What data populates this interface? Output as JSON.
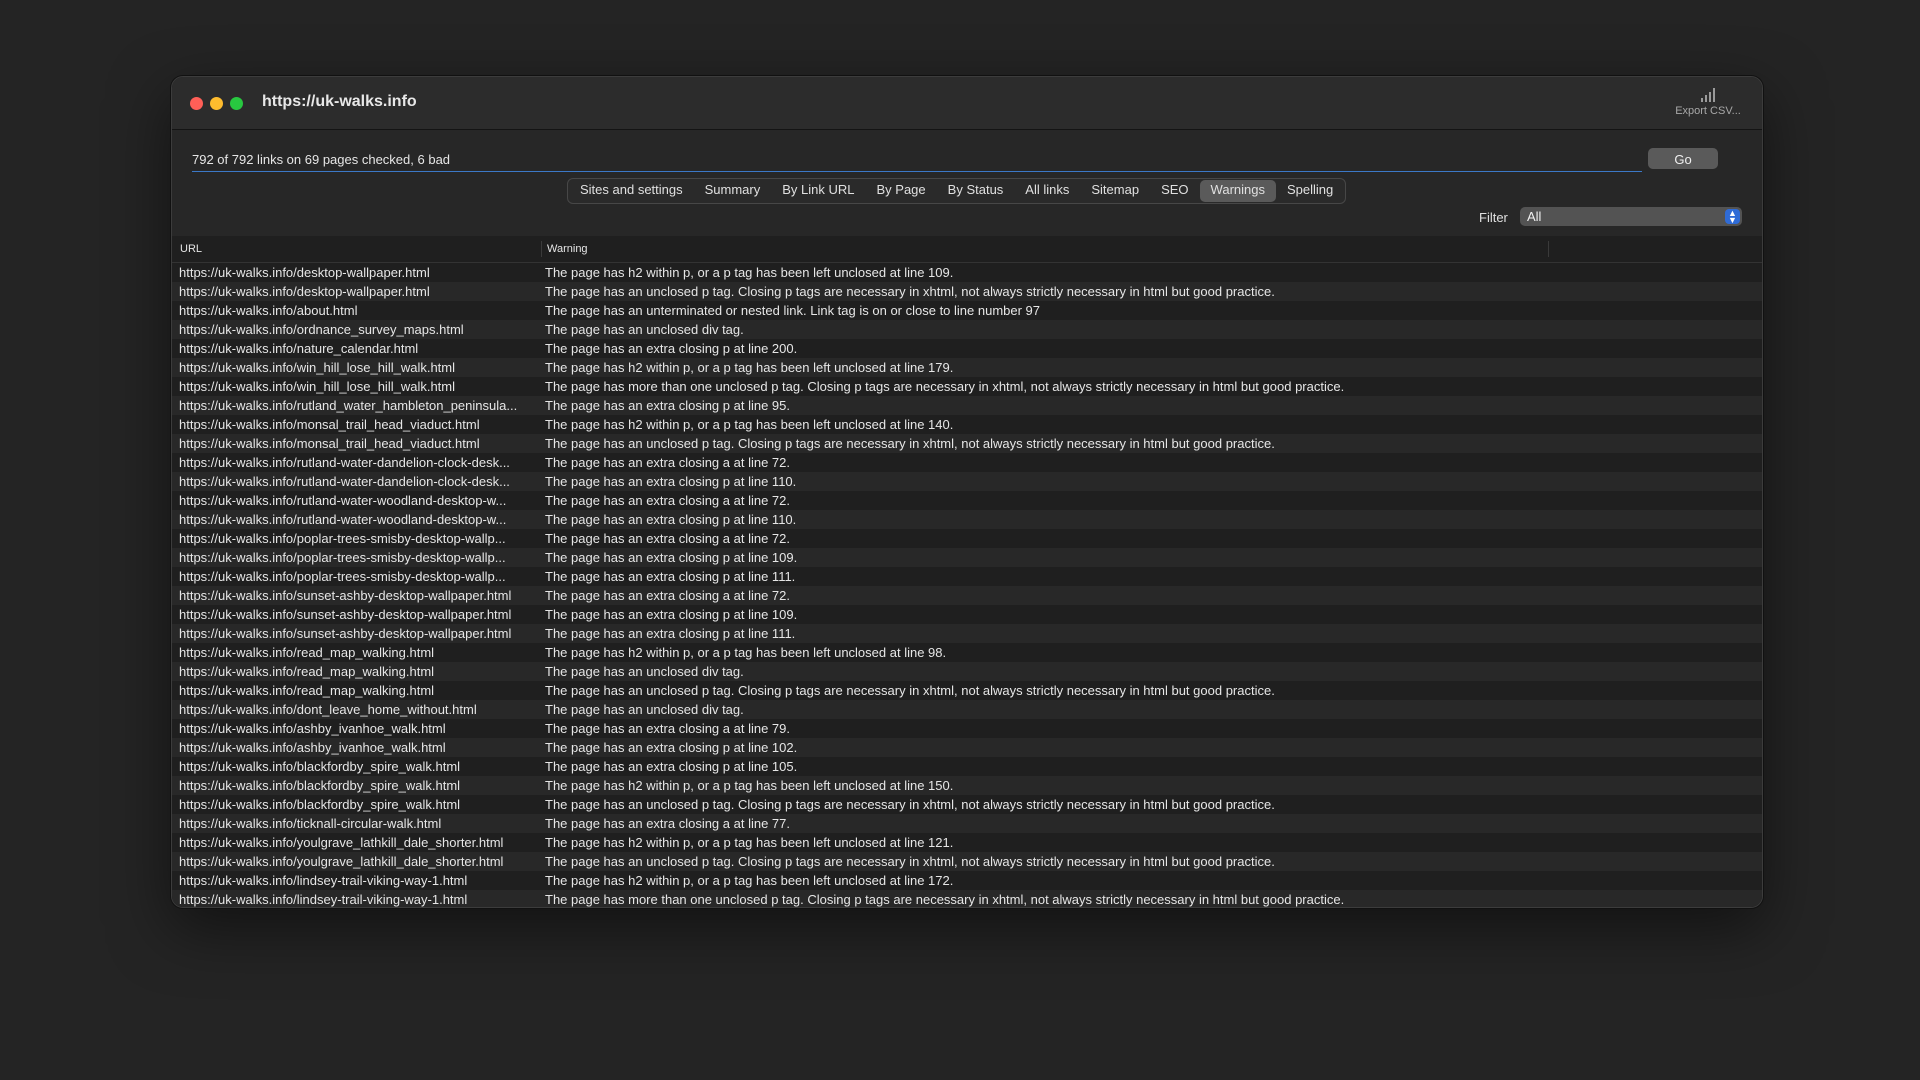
{
  "window": {
    "title": "https://uk-walks.info",
    "export_label": "Export CSV..."
  },
  "toolbar": {
    "status": "792 of 792 links on 69 pages checked, 6 bad",
    "go_label": "Go",
    "tabs": [
      "Sites and settings",
      "Summary",
      "By Link URL",
      "By Page",
      "By Status",
      "All links",
      "Sitemap",
      "SEO",
      "Warnings",
      "Spelling"
    ],
    "active_tab": "Warnings",
    "filter_label": "Filter",
    "filter_value": "All"
  },
  "table": {
    "headers": {
      "url": "URL",
      "warning": "Warning"
    },
    "rows": [
      {
        "url": "https://uk-walks.info/desktop-wallpaper.html",
        "warning": "The page has h2 within p, or a p tag has been left unclosed at line 109."
      },
      {
        "url": "https://uk-walks.info/desktop-wallpaper.html",
        "warning": "The page has an unclosed p tag.  Closing p tags are necessary in xhtml, not always strictly necessary in html but good practice."
      },
      {
        "url": "https://uk-walks.info/about.html",
        "warning": "The page has an unterminated or nested link. Link tag is on or close to line number 97"
      },
      {
        "url": "https://uk-walks.info/ordnance_survey_maps.html",
        "warning": "The page has an unclosed div tag."
      },
      {
        "url": "https://uk-walks.info/nature_calendar.html",
        "warning": "The page has an extra closing p at line 200."
      },
      {
        "url": "https://uk-walks.info/win_hill_lose_hill_walk.html",
        "warning": "The page has h2 within p, or a p tag has been left unclosed at line 179."
      },
      {
        "url": "https://uk-walks.info/win_hill_lose_hill_walk.html",
        "warning": "The page has more than one unclosed p tag. Closing p tags are necessary in xhtml, not always strictly necessary in html but good practice."
      },
      {
        "url": "https://uk-walks.info/rutland_water_hambleton_peninsula...",
        "warning": "The page has an extra closing p at line 95."
      },
      {
        "url": "https://uk-walks.info/monsal_trail_head_viaduct.html",
        "warning": "The page has h2 within p, or a p tag has been left unclosed at line 140."
      },
      {
        "url": "https://uk-walks.info/monsal_trail_head_viaduct.html",
        "warning": "The page has an unclosed p tag.  Closing p tags are necessary in xhtml, not always strictly necessary in html but good practice."
      },
      {
        "url": "https://uk-walks.info/rutland-water-dandelion-clock-desk...",
        "warning": "The page has an extra closing a at line 72."
      },
      {
        "url": "https://uk-walks.info/rutland-water-dandelion-clock-desk...",
        "warning": "The page has an extra closing p at line 110."
      },
      {
        "url": "https://uk-walks.info/rutland-water-woodland-desktop-w...",
        "warning": "The page has an extra closing a at line 72."
      },
      {
        "url": "https://uk-walks.info/rutland-water-woodland-desktop-w...",
        "warning": "The page has an extra closing p at line 110."
      },
      {
        "url": "https://uk-walks.info/poplar-trees-smisby-desktop-wallp...",
        "warning": "The page has an extra closing a at line 72."
      },
      {
        "url": "https://uk-walks.info/poplar-trees-smisby-desktop-wallp...",
        "warning": "The page has an extra closing p at line 109."
      },
      {
        "url": "https://uk-walks.info/poplar-trees-smisby-desktop-wallp...",
        "warning": "The page has an extra closing p at line 111."
      },
      {
        "url": "https://uk-walks.info/sunset-ashby-desktop-wallpaper.html",
        "warning": "The page has an extra closing a at line 72."
      },
      {
        "url": "https://uk-walks.info/sunset-ashby-desktop-wallpaper.html",
        "warning": "The page has an extra closing p at line 109."
      },
      {
        "url": "https://uk-walks.info/sunset-ashby-desktop-wallpaper.html",
        "warning": "The page has an extra closing p at line 111."
      },
      {
        "url": "https://uk-walks.info/read_map_walking.html",
        "warning": "The page has h2 within p, or a p tag has been left unclosed at line 98."
      },
      {
        "url": "https://uk-walks.info/read_map_walking.html",
        "warning": "The page has an unclosed div tag."
      },
      {
        "url": "https://uk-walks.info/read_map_walking.html",
        "warning": "The page has an unclosed p tag.  Closing p tags are necessary in xhtml, not always strictly necessary in html but good practice."
      },
      {
        "url": "https://uk-walks.info/dont_leave_home_without.html",
        "warning": "The page has an unclosed div tag."
      },
      {
        "url": "https://uk-walks.info/ashby_ivanhoe_walk.html",
        "warning": "The page has an extra closing a at line 79."
      },
      {
        "url": "https://uk-walks.info/ashby_ivanhoe_walk.html",
        "warning": "The page has an extra closing p at line 102."
      },
      {
        "url": "https://uk-walks.info/blackfordby_spire_walk.html",
        "warning": "The page has an extra closing p at line 105."
      },
      {
        "url": "https://uk-walks.info/blackfordby_spire_walk.html",
        "warning": "The page has h2 within p, or a p tag has been left unclosed at line 150."
      },
      {
        "url": "https://uk-walks.info/blackfordby_spire_walk.html",
        "warning": "The page has an unclosed p tag.  Closing p tags are necessary in xhtml, not always strictly necessary in html but good practice."
      },
      {
        "url": "https://uk-walks.info/ticknall-circular-walk.html",
        "warning": "The page has an extra closing a at line 77."
      },
      {
        "url": "https://uk-walks.info/youlgrave_lathkill_dale_shorter.html",
        "warning": "The page has h2 within p, or a p tag has been left unclosed at line 121."
      },
      {
        "url": "https://uk-walks.info/youlgrave_lathkill_dale_shorter.html",
        "warning": "The page has an unclosed p tag.  Closing p tags are necessary in xhtml, not always strictly necessary in html but good practice."
      },
      {
        "url": "https://uk-walks.info/lindsey-trail-viking-way-1.html",
        "warning": "The page has h2 within p, or a p tag has been left unclosed at line 172."
      },
      {
        "url": "https://uk-walks.info/lindsey-trail-viking-way-1.html",
        "warning": "The page has more than one unclosed p tag. Closing p tags are necessary in xhtml, not always strictly necessary in html but good practice."
      }
    ]
  },
  "colors": {
    "accent": "#2f6bd6",
    "close": "#ff5f57",
    "minimize": "#febc2e",
    "maximize": "#28c840"
  }
}
